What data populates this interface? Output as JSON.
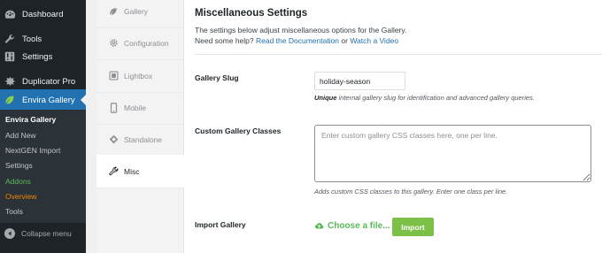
{
  "sidebar": {
    "items": [
      {
        "label": "Dashboard",
        "icon": "dashboard-icon"
      },
      {
        "label": "Tools",
        "icon": "wrench-icon"
      },
      {
        "label": "Settings",
        "icon": "settings-icon"
      },
      {
        "label": "Duplicator Pro",
        "icon": "duplicator-icon"
      },
      {
        "label": "Envira Gallery",
        "icon": "leaf-icon"
      }
    ],
    "submenu": [
      "Envira Gallery",
      "Add New",
      "NextGEN Import",
      "Settings",
      "Addons",
      "Overview",
      "Tools"
    ],
    "collapse_label": "Collapse menu"
  },
  "tabs": [
    {
      "label": "Gallery",
      "icon": "leaf-icon"
    },
    {
      "label": "Configuration",
      "icon": "gear-icon"
    },
    {
      "label": "Lightbox",
      "icon": "lightbox-icon"
    },
    {
      "label": "Mobile",
      "icon": "mobile-icon"
    },
    {
      "label": "Standalone",
      "icon": "standalone-icon"
    },
    {
      "label": "Misc",
      "icon": "wrench-icon"
    }
  ],
  "main": {
    "title": "Miscellaneous Settings",
    "desc_line1": "The settings below adjust miscellaneous options for the Gallery.",
    "desc_line2_prefix": "Need some help? ",
    "doc_link": "Read the Documentation",
    "or_text": " or ",
    "video_link": "Watch a Video",
    "slug": {
      "label": "Gallery Slug",
      "value": "holiday-season",
      "help_bold": "Unique",
      "help_rest": " internal gallery slug for identification and advanced gallery queries."
    },
    "classes": {
      "label": "Custom Gallery Classes",
      "placeholder": "Enter custom gallery CSS classes here, one per line.",
      "help": "Adds custom CSS classes to this gallery. Enter one class per line."
    },
    "import": {
      "label": "Import Gallery",
      "choose_label": "Choose a file...",
      "button_label": "Import"
    }
  },
  "colors": {
    "sidebar_bg": "#1d2327",
    "active_blue": "#2271b1",
    "envira_green": "#7cc048",
    "link_blue": "#2271b1"
  }
}
